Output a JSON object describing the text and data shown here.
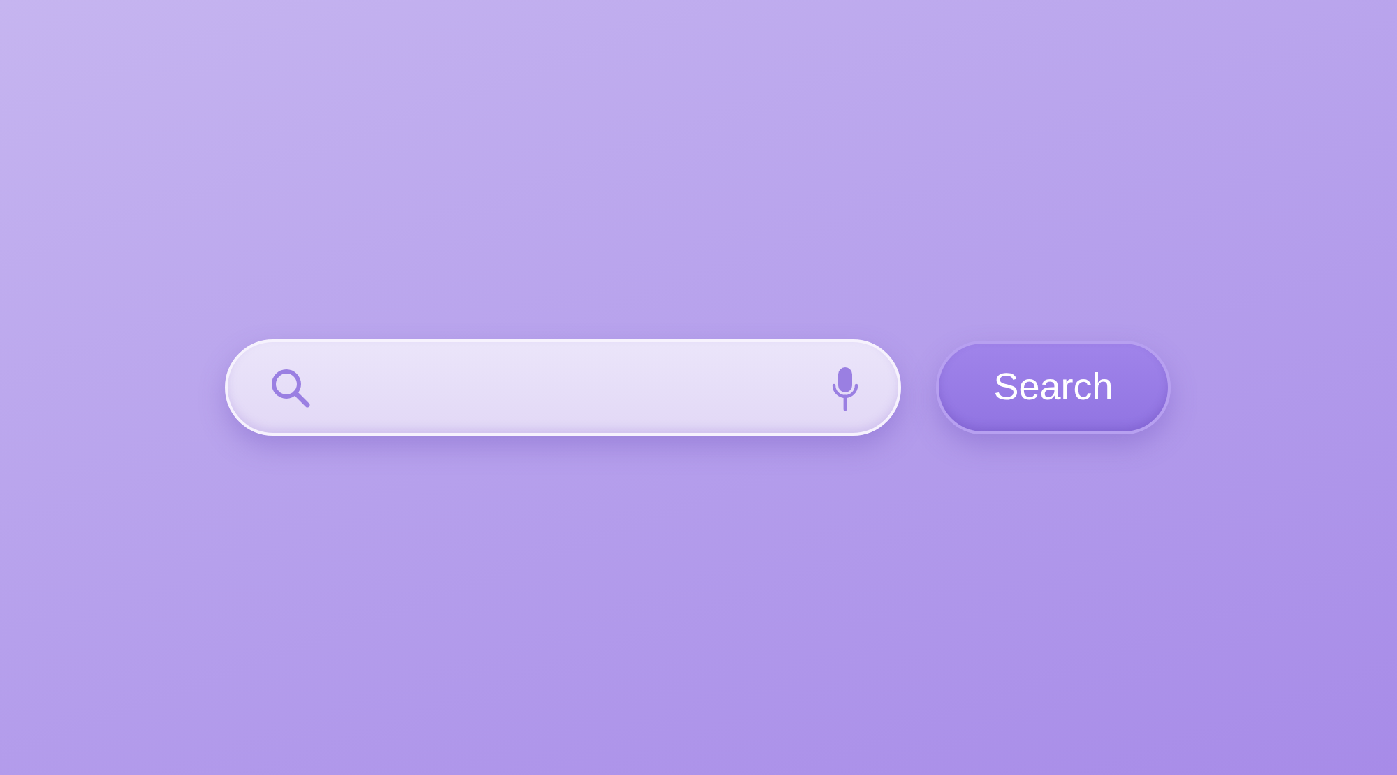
{
  "search_button": {
    "label": "Search"
  }
}
